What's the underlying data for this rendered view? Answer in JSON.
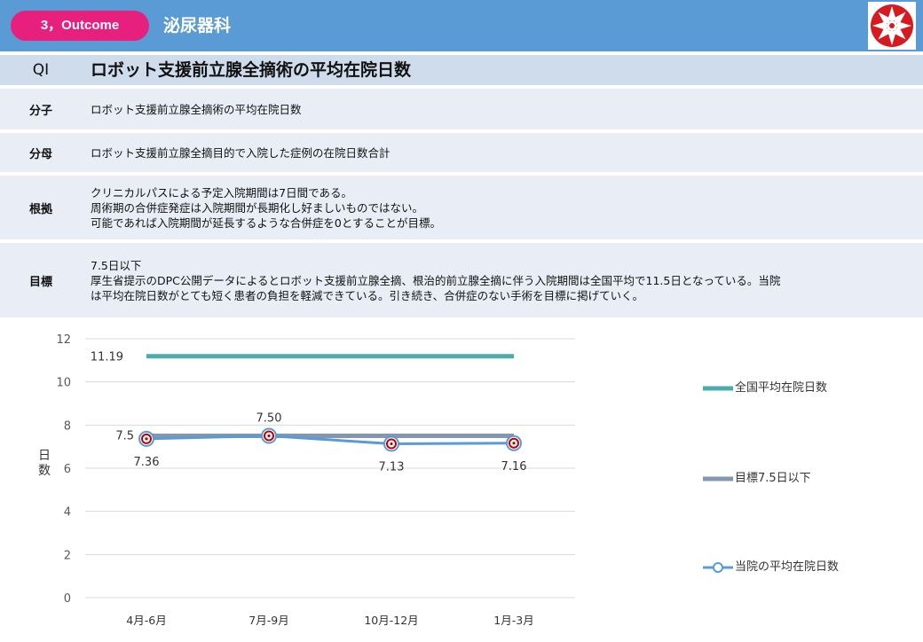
{
  "header": {
    "badge": "3，Outcome",
    "department": "泌尿器科"
  },
  "qi": {
    "label": "QI",
    "title": "ロボット支援前立腺全摘術の平均在院日数"
  },
  "rows": [
    {
      "label": "分子",
      "lines": [
        "ロボット支援前立腺全摘術の平均在院日数"
      ]
    },
    {
      "label": "分母",
      "lines": [
        "ロボット支援前立腺全摘目的で入院した症例の在院日数合計"
      ]
    },
    {
      "label": "根拠",
      "lines": [
        "クリニカルパスによる予定入院期間は7日間である。",
        "周術期の合併症発症は入院期間が長期化し好ましいものではない。",
        "可能であれば入院期間が延長するような合併症を0とすることが目標。"
      ]
    },
    {
      "label": "目標",
      "lines": [
        "7.5日以下",
        "厚生省提示のDPC公開データによるとロボット支援前立腺全摘、根治的前立腺全摘に伴う入院期間は全国平均で11.5日となっている。当院",
        "は平均在院日数がとても短く患者の負担を軽減できている。引き続き、合併症のない手術を目標に掲げていく。"
      ]
    }
  ],
  "colors": {
    "header": "#5b9bd5",
    "badge": "#e8207d",
    "national": "#4bacac",
    "target": "#8497b0",
    "hospital": "#5b9bd5",
    "marker_ring": "#c00000"
  },
  "chart_data": {
    "type": "line",
    "categories": [
      "4月-6月",
      "7月-9月",
      "10月-12月",
      "1月-3月"
    ],
    "ylabel": "日数",
    "ylim": [
      0,
      12
    ],
    "yticks": [
      0,
      2,
      4,
      6,
      8,
      10,
      12
    ],
    "grid": true,
    "legend_position": "right",
    "series": [
      {
        "name": "全国平均在院日数",
        "values": [
          11.19,
          11.19,
          11.19,
          11.19
        ],
        "data_labels": [
          "11.19",
          "",
          "",
          ""
        ]
      },
      {
        "name": "目標7.5日以下",
        "values": [
          7.5,
          7.5,
          7.5,
          7.5
        ],
        "data_labels": [
          "7.5",
          "",
          "",
          ""
        ]
      },
      {
        "name": "当院の平均在院日数",
        "values": [
          7.36,
          7.5,
          7.13,
          7.16
        ],
        "data_labels": [
          "7.36",
          "7.50",
          "7.13",
          "7.16"
        ]
      }
    ]
  }
}
